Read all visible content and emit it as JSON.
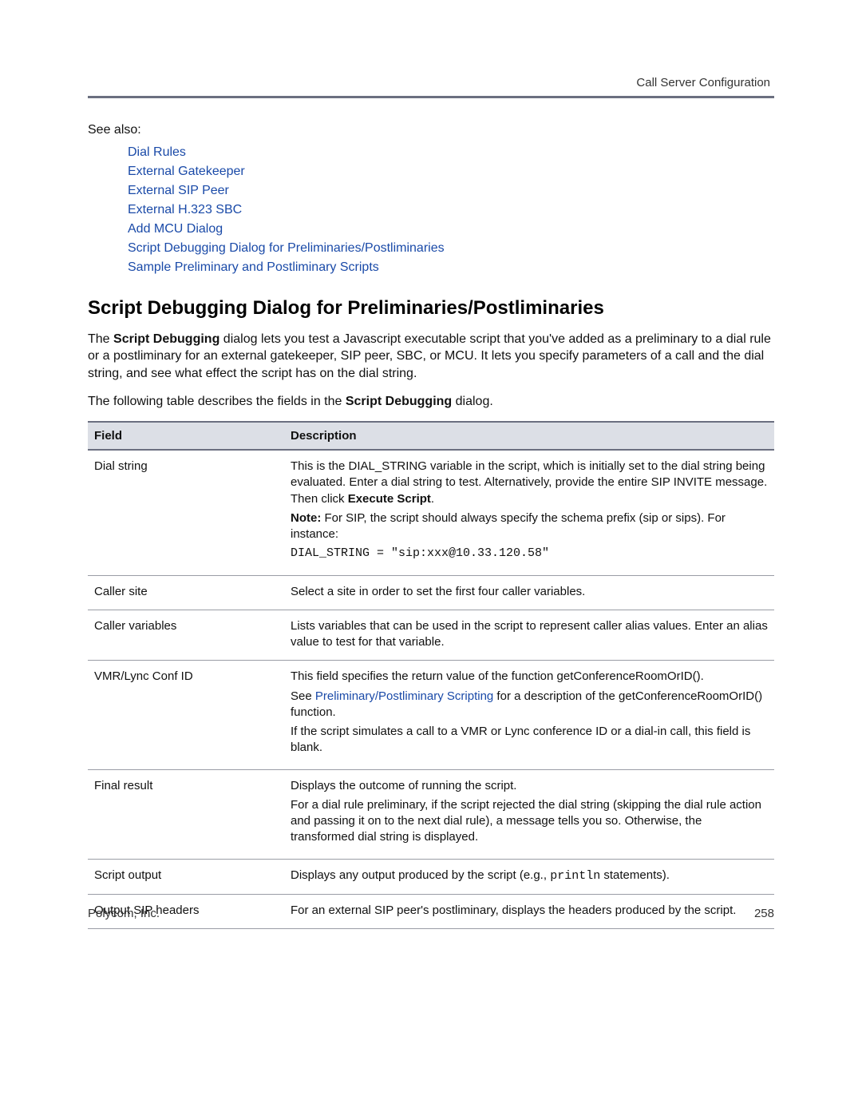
{
  "header": {
    "right": "Call Server Configuration"
  },
  "see_also_label": "See also:",
  "see_also_links": [
    "Dial Rules",
    "External Gatekeeper",
    "External SIP Peer",
    "External H.323 SBC",
    "Add MCU Dialog",
    "Script Debugging Dialog for Preliminaries/Postliminaries",
    "Sample Preliminary and Postliminary Scripts"
  ],
  "section_title": "Script Debugging Dialog for Preliminaries/Postliminaries",
  "para1_a": "The ",
  "para1_b": "Script Debugging",
  "para1_c": " dialog lets you test a Javascript executable script that you've added as a preliminary to a dial rule or a postliminary for an external gatekeeper, SIP peer, SBC, or MCU. It lets you specify parameters of a call and the dial string, and see what effect the script has on the dial string.",
  "para2_a": "The following table describes the fields in the ",
  "para2_b": "Script Debugging",
  "para2_c": " dialog.",
  "table": {
    "head_field": "Field",
    "head_desc": "Description",
    "rows": {
      "r0": {
        "field": "Dial string",
        "d1": "This is the DIAL_STRING variable in the script, which is initially set to the dial string being evaluated. Enter a dial string to test. Alternatively, provide the entire SIP INVITE message. Then click ",
        "d1b": "Execute Script",
        "d1c": ".",
        "d2a": "Note:",
        "d2b": " For SIP, the script should always specify the schema prefix (sip or sips). For instance:",
        "d3": "DIAL_STRING = \"sip:xxx@10.33.120.58\""
      },
      "r1": {
        "field": "Caller site",
        "d1": "Select a site in order to set the first four caller variables."
      },
      "r2": {
        "field": "Caller variables",
        "d1": "Lists variables that can be used in the script to represent caller alias values. Enter an alias value to test for that variable."
      },
      "r3": {
        "field": "VMR/Lync Conf ID",
        "d1": "This field specifies the return value of the function getConferenceRoomOrID().",
        "d2a": "See ",
        "d2link": "Preliminary/Postliminary Scripting",
        "d2b": " for a description of the getConferenceRoomOrID() function.",
        "d3": "If the script simulates a call to a VMR or Lync conference ID or a dial-in call, this field is blank."
      },
      "r4": {
        "field": "Final result",
        "d1": "Displays the outcome of running the script.",
        "d2": "For a dial rule preliminary, if the script rejected the dial string (skipping the dial rule action and passing it on to the next dial rule), a message tells you so. Otherwise, the transformed dial string is displayed."
      },
      "r5": {
        "field": "Script output",
        "d1a": "Displays any output produced by the script (e.g., ",
        "d1m": "println",
        "d1b": " statements)."
      },
      "r6": {
        "field": "Output SIP headers",
        "d1": "For an external SIP peer's postliminary, displays the headers produced by the script."
      }
    }
  },
  "footer": {
    "left": "Polycom, Inc.",
    "right": "258"
  }
}
